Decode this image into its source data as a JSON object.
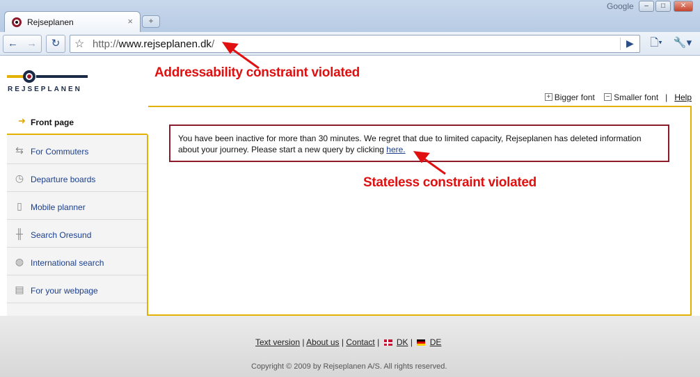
{
  "browser": {
    "tab_title": "Rejseplanen",
    "tab_close": "×",
    "new_tab": "+",
    "search_engine": "Google",
    "url_prefix": "http://",
    "url_host": "www.rejseplanen.dk",
    "url_suffix": "/"
  },
  "site": {
    "logo_text": "REJSEPLANEN",
    "bigger_font": "Bigger font",
    "smaller_font": "Smaller font",
    "separator": "|",
    "help": "Help"
  },
  "menu": {
    "active": "Front page",
    "items": [
      {
        "label": "For Commuters",
        "icon": "commuter-arrows-icon"
      },
      {
        "label": "Departure boards",
        "icon": "clock-icon"
      },
      {
        "label": "Mobile planner",
        "icon": "mobile-phone-icon"
      },
      {
        "label": "Search Oresund",
        "icon": "bridge-icon"
      },
      {
        "label": "International search",
        "icon": "globe-icon"
      },
      {
        "label": "For your webpage",
        "icon": "computer-icon"
      }
    ]
  },
  "notice": {
    "text": "You have been inactive for more than 30 minutes. We regret that due to limited capacity, Rejseplanen has deleted information about your journey. Please start a new query by clicking ",
    "link": "here."
  },
  "footer": {
    "text_version": "Text version",
    "about_us": "About us",
    "contact": "Contact",
    "dk": "DK",
    "de": "DE",
    "sep": "|",
    "copyright": "Copyright © 2009 by Rejseplanen A/S. All rights reserved."
  },
  "annotations": {
    "addressability": "Addressability constraint violated",
    "stateless": "Stateless constraint violated"
  },
  "colors": {
    "brand_yellow": "#e3b100",
    "brand_navy": "#1a2a47",
    "notice_border": "#8b1a2b",
    "annotation_red": "#e01010"
  }
}
